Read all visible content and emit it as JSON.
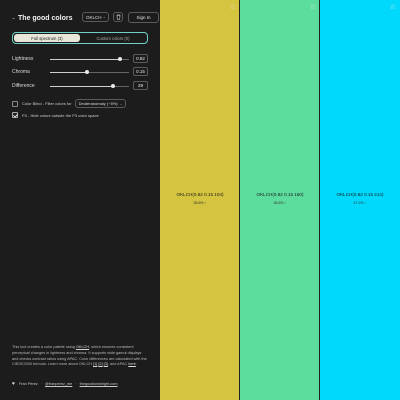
{
  "header": {
    "logo": "...",
    "title": "The good colors",
    "space_select": "OKLCH",
    "space_select_chevron": "⌄",
    "signin_label": "Sign In"
  },
  "tabs": [
    {
      "label": "Full spectrum (3)",
      "active": true
    },
    {
      "label": "Custom colors (0)",
      "active": false
    }
  ],
  "sliders": [
    {
      "label": "Lightness",
      "value": "0.82",
      "fraction": 0.88
    },
    {
      "label": "Chroma",
      "value": "0.15",
      "fraction": 0.47
    },
    {
      "label": "Difference",
      "value": "29",
      "fraction": 0.8
    }
  ],
  "options": {
    "color_blind_label": "Color Blind - Filter colors for",
    "color_blind_checked": false,
    "color_blind_select": "Deuteranomaly (~5%)",
    "p3_label": "P3 - Hide colors outside the P3 color space",
    "p3_checked": true
  },
  "about": {
    "part1": "This tool creates a color palette using ",
    "link_oklch": "OKLCH",
    "part2": ", which ensures consistent perceptual changes in lightness and chroma. It supports wide gamut displays and checks contrast ratios using APAC. Color differences are calculated with the CIEDE2000 formula. Learn more about OKLCH ",
    "link1": "[1]",
    "link2": "[2]",
    "link3": "[3]",
    "part3": ", and APAC ",
    "link_here": "here",
    "part4": "."
  },
  "footer": {
    "author": "Fran Pérez",
    "handle": "@franperez_me",
    "site": "thegoodlowheight.com"
  },
  "swatches": [
    {
      "color": "#d4c43f",
      "code": "OKLCH(0.82 0.15 104)",
      "contrast": "38.8% ↑",
      "star": "☆"
    },
    {
      "color": "#5ddd9d",
      "code": "OKLCH(0.82 0.15 160)",
      "contrast": "38.8% ↑",
      "star": "☆"
    },
    {
      "color": "#00d9fb",
      "code": "OKLCH(0.82 0.15 214)",
      "contrast": "47.2% ↑",
      "star": "☆"
    }
  ]
}
